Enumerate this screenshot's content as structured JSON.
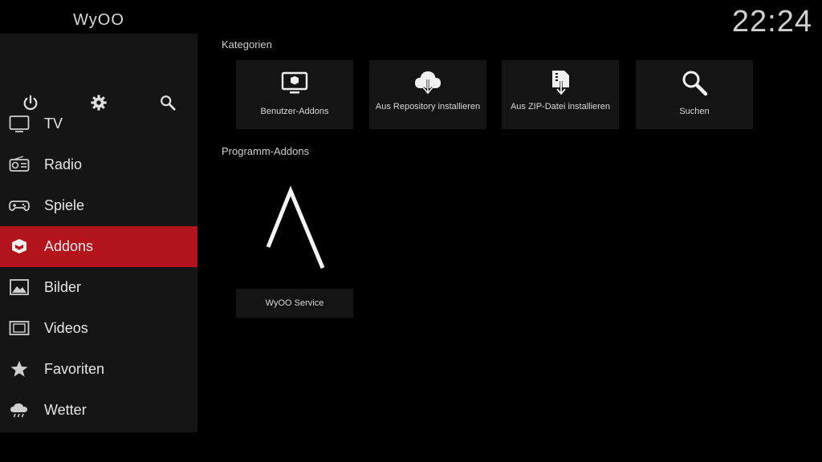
{
  "app": {
    "brand": "WyOO",
    "clock": "22:24"
  },
  "system_buttons": [
    {
      "icon": "power-icon"
    },
    {
      "icon": "gear-icon"
    },
    {
      "icon": "search-icon"
    }
  ],
  "sidebar": {
    "items": [
      {
        "label": "TV",
        "icon": "tv-icon"
      },
      {
        "label": "Radio",
        "icon": "radio-icon"
      },
      {
        "label": "Spiele",
        "icon": "gamepad-icon"
      },
      {
        "label": "Addons",
        "icon": "addon-box-icon",
        "active": true
      },
      {
        "label": "Bilder",
        "icon": "picture-icon"
      },
      {
        "label": "Videos",
        "icon": "film-icon"
      },
      {
        "label": "Favoriten",
        "icon": "star-icon"
      },
      {
        "label": "Wetter",
        "icon": "weather-icon"
      }
    ]
  },
  "main": {
    "categories_title": "Kategorien",
    "categories": [
      {
        "label": "Benutzer-Addons",
        "icon": "monitor-box-icon"
      },
      {
        "label": "Aus Repository installieren",
        "icon": "cloud-download-icon"
      },
      {
        "label": "Aus ZIP-Datei installieren",
        "icon": "zip-download-icon"
      },
      {
        "label": "Suchen",
        "icon": "search-icon"
      }
    ],
    "program_addons_title": "Programm-Addons",
    "program_addons": [
      {
        "label": "WyOO Service",
        "icon": "wyoo-lambda-logo-icon"
      }
    ]
  },
  "colors": {
    "accent": "#b3141b",
    "sidebar_bg": "#151515",
    "tile_bg": "#141414",
    "background": "#000000"
  }
}
